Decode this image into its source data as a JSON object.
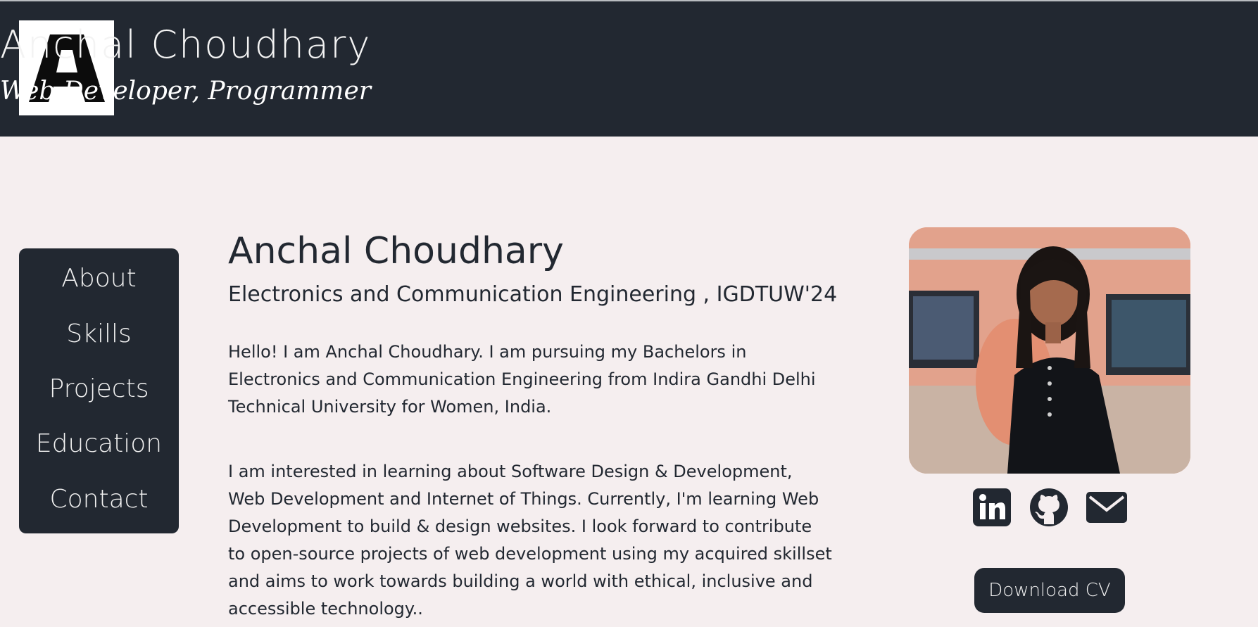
{
  "header": {
    "logo_letter": "A",
    "name": "Anchal Choudhary",
    "role": "Web Developer, Programmer"
  },
  "nav": {
    "items": [
      {
        "label": "About"
      },
      {
        "label": "Skills"
      },
      {
        "label": "Projects"
      },
      {
        "label": "Education"
      },
      {
        "label": "Contact"
      }
    ]
  },
  "main": {
    "name": "Anchal Choudhary",
    "degree": "Electronics and Communication Engineering , IGDTUW'24",
    "paragraphs": [
      "Hello! I am Anchal Choudhary. I am pursuing my Bachelors in Electronics and Communication Engineering from Indira Gandhi Delhi Technical University for Women, India.",
      "I am interested in learning about Software Design & Development, Web Development and Internet of Things. Currently, I'm learning Web Development to build & design websites. I look forward to contribute to open-source projects of web development using my acquired skillset and aims to work towards building a world with ethical, inclusive and accessible technology.."
    ]
  },
  "profile": {
    "social": [
      {
        "icon": "linkedin-icon"
      },
      {
        "icon": "github-icon"
      },
      {
        "icon": "mail-icon"
      }
    ],
    "download_label": "Download CV"
  },
  "colors": {
    "dark": "#222831",
    "background": "#f5eeef",
    "light_text": "#f1f1f1"
  }
}
